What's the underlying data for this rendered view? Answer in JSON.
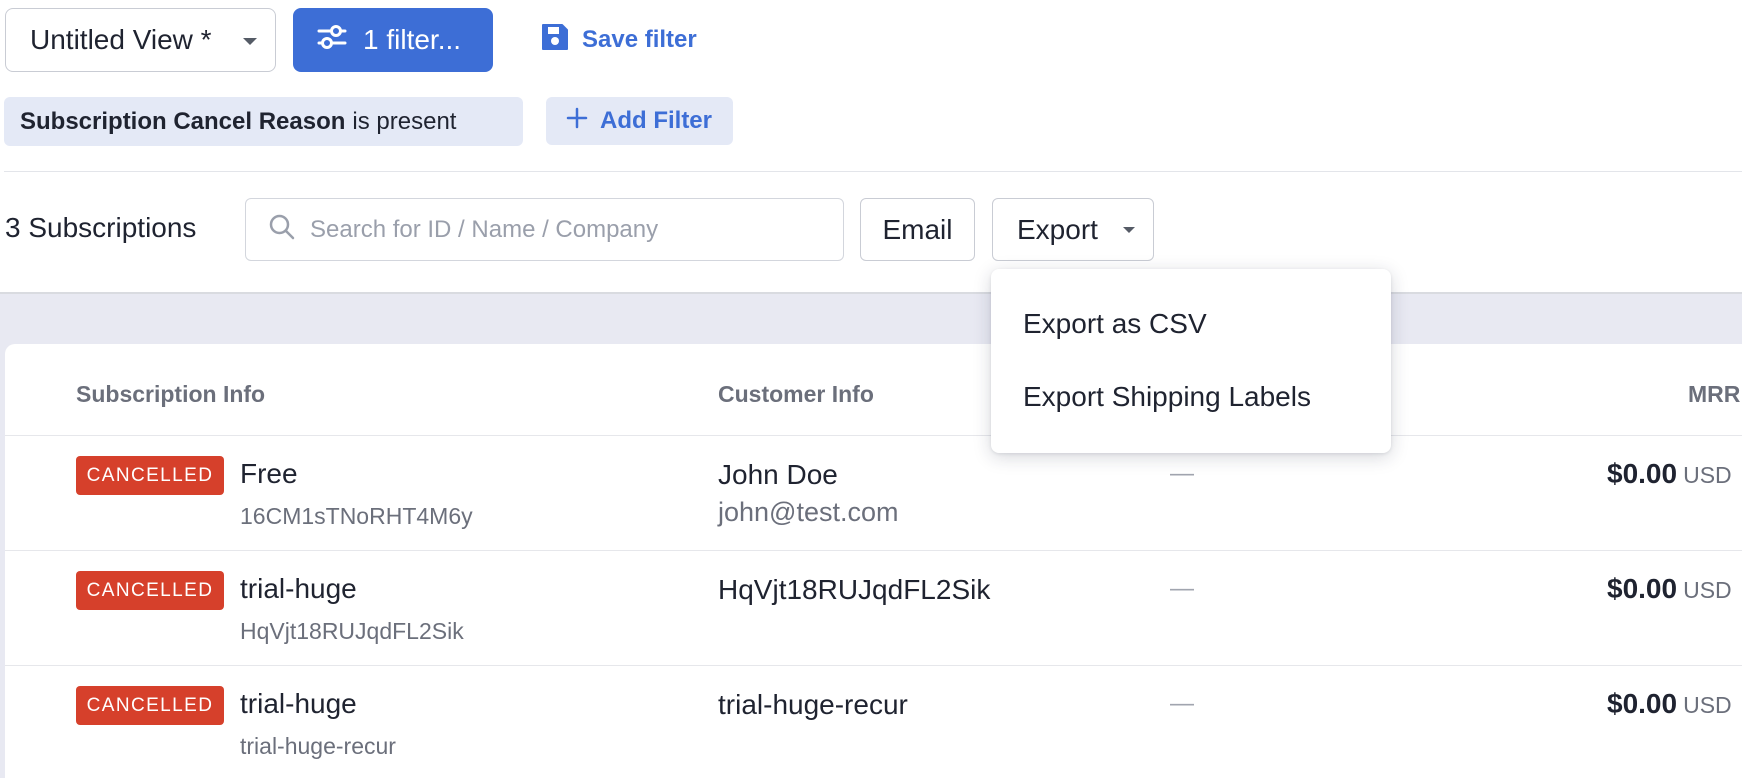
{
  "toolbar": {
    "view_name": "Untitled View *",
    "filter_button": "1 filter...",
    "save_filter": "Save filter"
  },
  "filters": {
    "active": [
      {
        "field": "Subscription Cancel Reason",
        "operator": "is present"
      }
    ],
    "add_filter": "Add Filter"
  },
  "subscriptions": {
    "count_label": "3 Subscriptions",
    "search_placeholder": "Search for ID / Name / Company",
    "search_value": "",
    "email_button": "Email",
    "export_button": "Export"
  },
  "export_menu": {
    "items": [
      "Export as CSV",
      "Export Shipping Labels"
    ]
  },
  "table": {
    "columns": [
      "Subscription Info",
      "Customer Info",
      "MRR"
    ],
    "rows": [
      {
        "status": "CANCELLED",
        "plan": "Free",
        "subscription_id": "16CM1sTNoRHT4M6y",
        "customer_name": "John Doe",
        "customer_email": "john@test.com",
        "extra": "—",
        "mrr": "$0.00",
        "currency": "USD"
      },
      {
        "status": "CANCELLED",
        "plan": "trial-huge",
        "subscription_id": "HqVjt18RUJqdFL2Sik",
        "customer_name": "HqVjt18RUJqdFL2Sik",
        "customer_email": "",
        "extra": "—",
        "mrr": "$0.00",
        "currency": "USD"
      },
      {
        "status": "CANCELLED",
        "plan": "trial-huge",
        "subscription_id": "trial-huge-recur",
        "customer_name": "trial-huge-recur",
        "customer_email": "",
        "extra": "—",
        "mrr": "$0.00",
        "currency": "USD"
      }
    ]
  },
  "colors": {
    "primary": "#3d6ed6",
    "cancelled_badge": "#d6402b",
    "chip_background": "#e4e9f6",
    "page_band": "#e8e9f2"
  },
  "icons": {
    "filter_button": "sliders-icon",
    "save_filter": "floppy-disk-icon",
    "add_filter": "plus-icon",
    "search": "search-icon"
  }
}
